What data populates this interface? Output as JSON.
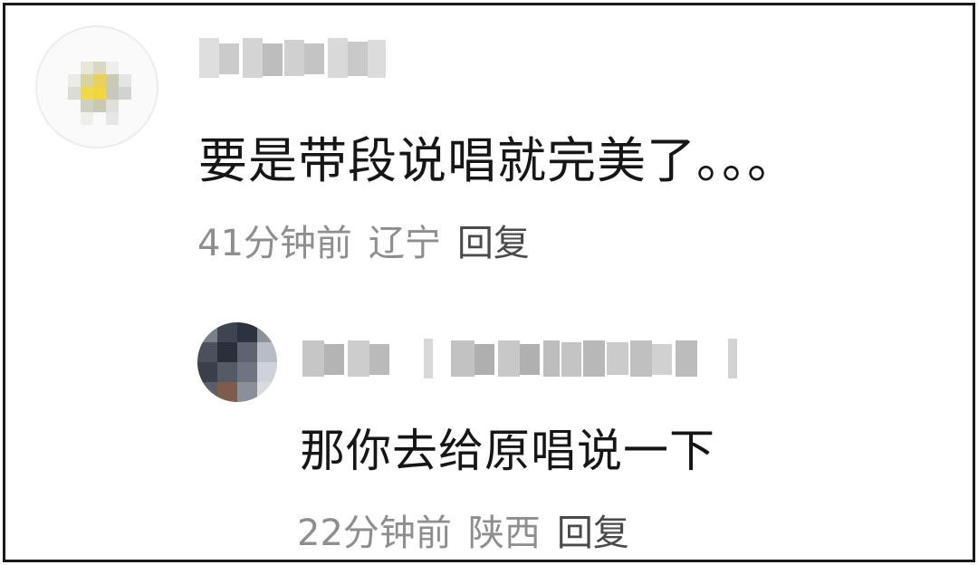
{
  "comments": [
    {
      "text": "要是带段说唱就完美了。。。",
      "time": "41分钟前",
      "location": "辽宁",
      "reply_label": "回复",
      "username_blurred": true
    },
    {
      "text": "那你去给原唱说一下",
      "time": "22分钟前",
      "location": "陕西",
      "reply_label": "回复",
      "username_blurred": true
    }
  ],
  "colors": {
    "text": "#161616",
    "meta": "#8e8e8e",
    "reply": "#4a4a4a",
    "frame_border": "#1a1a1a"
  },
  "icons": [
    "avatar-pixelated",
    "avatar-pixelated"
  ]
}
